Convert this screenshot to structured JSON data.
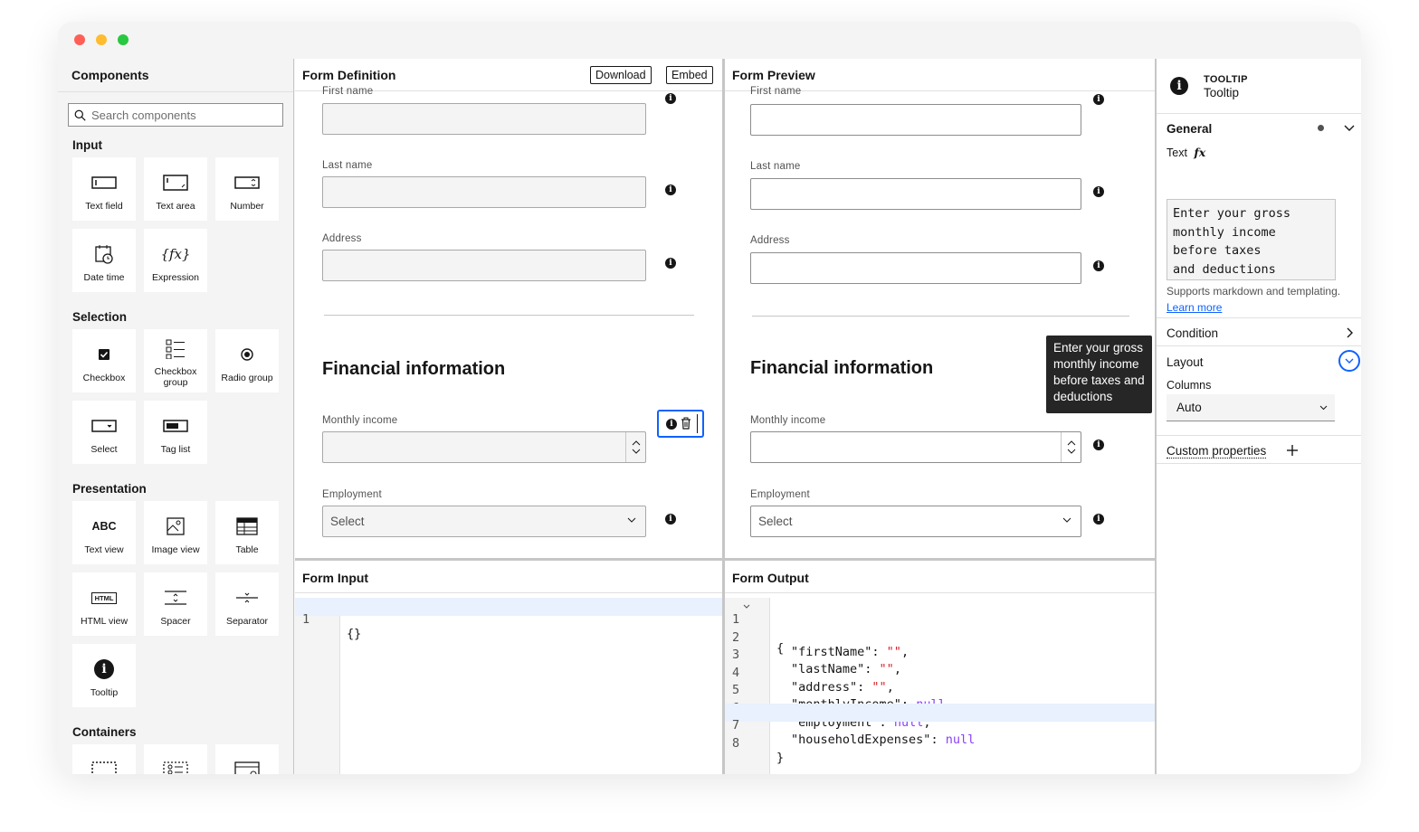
{
  "palette": {
    "title": "Components",
    "search_placeholder": "Search components",
    "categories": {
      "input": "Input",
      "selection": "Selection",
      "presentation": "Presentation",
      "containers": "Containers"
    },
    "items": {
      "text_field": "Text field",
      "text_area": "Text area",
      "number": "Number",
      "date_time": "Date time",
      "expression": "Expression",
      "checkbox": "Checkbox",
      "checkbox_group": "Checkbox group",
      "radio_group": "Radio group",
      "select": "Select",
      "tag_list": "Tag list",
      "text_view": "Text view",
      "image_view": "Image view",
      "table": "Table",
      "html_view": "HTML view",
      "spacer": "Spacer",
      "separator": "Separator",
      "tooltip": "Tooltip"
    },
    "icon_text": {
      "text_view": "ABC",
      "html": "HTML",
      "fx": "{𝑓x}"
    }
  },
  "definition": {
    "title": "Form Definition",
    "download_label": "Download",
    "embed_label": "Embed"
  },
  "preview": {
    "title": "Form Preview"
  },
  "form": {
    "first_name": "First name",
    "last_name": "Last name",
    "address": "Address",
    "section_title": "Financial information",
    "monthly_income": "Monthly income",
    "employment": "Employment",
    "select_placeholder": "Select"
  },
  "tooltip_popup": "Enter your gross monthly income before taxes and deductions",
  "form_input": {
    "title": "Form Input",
    "lines": [
      "{}"
    ]
  },
  "form_output": {
    "title": "Form Output",
    "line_numbers": [
      "1",
      "2",
      "3",
      "4",
      "5",
      "6",
      "7",
      "8"
    ],
    "keys": [
      "\"firstName\"",
      "\"lastName\"",
      "\"address\"",
      "\"monthlyIncome\"",
      "\"employment\"",
      "\"householdExpenses\""
    ],
    "values": [
      "\"\"",
      "\"\"",
      "\"\"",
      "null",
      "null",
      "null"
    ],
    "open": "{",
    "close": "}"
  },
  "properties": {
    "type": "TOOLTIP",
    "name": "Tooltip",
    "general_label": "General",
    "text_label": "Text",
    "fx_label": "fx",
    "text_value": "Enter your gross\nmonthly income\nbefore taxes\nand deductions",
    "helper_text": "Supports markdown and templating.",
    "learn_more": "Learn more",
    "condition_label": "Condition",
    "layout_label": "Layout",
    "columns_label": "Columns",
    "columns_value": "Auto",
    "custom_properties": "Custom properties"
  },
  "colors": {
    "accent": "#0f62fe",
    "string": "#da1e28",
    "keyword": "#8a3ffc",
    "tooltip_bg": "#262626"
  }
}
